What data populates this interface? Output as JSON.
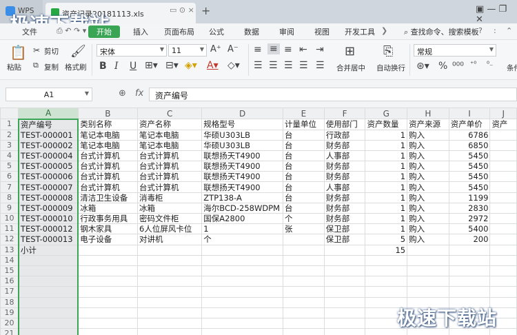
{
  "titlebar": {
    "app": "WPS",
    "doc_name": "资产记录20181113.xls",
    "tab_btns": "▭ ⊙ ×",
    "new_tab": "+",
    "win_ctrls": "▣  —  ❐  ✕"
  },
  "watermark": "极速下载站",
  "menu": {
    "items": [
      "文件",
      "开始",
      "插入",
      "页面布局",
      "公式",
      "数据",
      "审阅",
      "视图",
      "开发工具"
    ],
    "active": "开始",
    "search": "查找命令、搜索模板",
    "help": "?",
    "more": ":"
  },
  "toolbar": {
    "paste": "粘贴",
    "cut": "剪切",
    "copy": "复制",
    "format_painter": "格式刷",
    "font_name": "宋体",
    "font_size": "11",
    "font_grow": "A⁺",
    "font_shrink": "A⁻",
    "bold": "B",
    "italic": "I",
    "underline": "U",
    "merge": "合并居中",
    "wrap": "自动换行",
    "number_format": "常规",
    "condition": "条件"
  },
  "formula_bar": {
    "cell_ref": "A1",
    "fx": "fx",
    "content": "资产编号"
  },
  "sheet": {
    "columns": [
      "A",
      "B",
      "C",
      "D",
      "E",
      "F",
      "G",
      "H",
      "I",
      "J"
    ],
    "rows": [
      [
        "资产编号",
        "类别名称",
        "资产名称",
        "规格型号",
        "计量单位",
        "使用部门",
        "资产数量",
        "资产来源",
        "资产单价",
        "资产"
      ],
      [
        "TEST-000001",
        "笔记本电脑",
        "笔记本电脑",
        "华硕U303LB",
        "台",
        "行政部",
        "1",
        "购入",
        "6786",
        ""
      ],
      [
        "TEST-000002",
        "笔记本电脑",
        "笔记本电脑",
        "华硕U303LB",
        "台",
        "财务部",
        "1",
        "购入",
        "6850",
        ""
      ],
      [
        "TEST-000004",
        "台式计算机",
        "台式计算机",
        "联想扬天T4900",
        "台",
        "人事部",
        "1",
        "购入",
        "5450",
        ""
      ],
      [
        "TEST-000005",
        "台式计算机",
        "台式计算机",
        "联想扬天T4900",
        "台",
        "财务部",
        "1",
        "购入",
        "5450",
        ""
      ],
      [
        "TEST-000006",
        "台式计算机",
        "台式计算机",
        "联想扬天T4900",
        "台",
        "财务部",
        "1",
        "购入",
        "5450",
        ""
      ],
      [
        "TEST-000007",
        "台式计算机",
        "台式计算机",
        "联想扬天T4900",
        "台",
        "人事部",
        "1",
        "购入",
        "5450",
        ""
      ],
      [
        "TEST-000008",
        "清洁卫生设备",
        "消毒柜",
        "ZTP138-A",
        "台",
        "财务部",
        "1",
        "购入",
        "1199",
        ""
      ],
      [
        "TEST-000009",
        "冰箱",
        "冰箱",
        "海尔BCD-258WDPM",
        "台",
        "财务部",
        "1",
        "购入",
        "2830",
        ""
      ],
      [
        "TEST-000010",
        "行政事务用具",
        "密码文件柜",
        "国保A2800",
        "个",
        "财务部",
        "1",
        "购入",
        "2972",
        ""
      ],
      [
        "TEST-000012",
        "钢木家具",
        "6人位屏风卡位",
        "1",
        "张",
        "保卫部",
        "1",
        "购入",
        "5400",
        ""
      ],
      [
        "TEST-000013",
        "电子设备",
        "对讲机",
        "个",
        "",
        "保卫部",
        "5",
        "购入",
        "200",
        ""
      ],
      [
        "小计",
        "",
        "",
        "",
        "",
        "",
        "15",
        "",
        "",
        ""
      ],
      [
        "",
        "",
        "",
        "",
        "",
        "",
        "",
        "",
        "",
        ""
      ],
      [
        "",
        "",
        "",
        "",
        "",
        "",
        "",
        "",
        "",
        ""
      ],
      [
        "",
        "",
        "",
        "",
        "",
        "",
        "",
        "",
        "",
        ""
      ],
      [
        "",
        "",
        "",
        "",
        "",
        "",
        "",
        "",
        "",
        ""
      ],
      [
        "",
        "",
        "",
        "",
        "",
        "",
        "",
        "",
        "",
        ""
      ],
      [
        "",
        "",
        "",
        "",
        "",
        "",
        "",
        "",
        "",
        ""
      ],
      [
        "",
        "",
        "",
        "",
        "",
        "",
        "",
        "",
        "",
        ""
      ],
      [
        "",
        "",
        "",
        "",
        "",
        "",
        "",
        "",
        "",
        ""
      ]
    ],
    "row_numbers": [
      "1",
      "2",
      "3",
      "4",
      "5",
      "6",
      "7",
      "8",
      "9",
      "10",
      "11",
      "12",
      "13",
      "14",
      "15",
      "16",
      "17",
      "18",
      "19",
      "20",
      "21"
    ]
  }
}
